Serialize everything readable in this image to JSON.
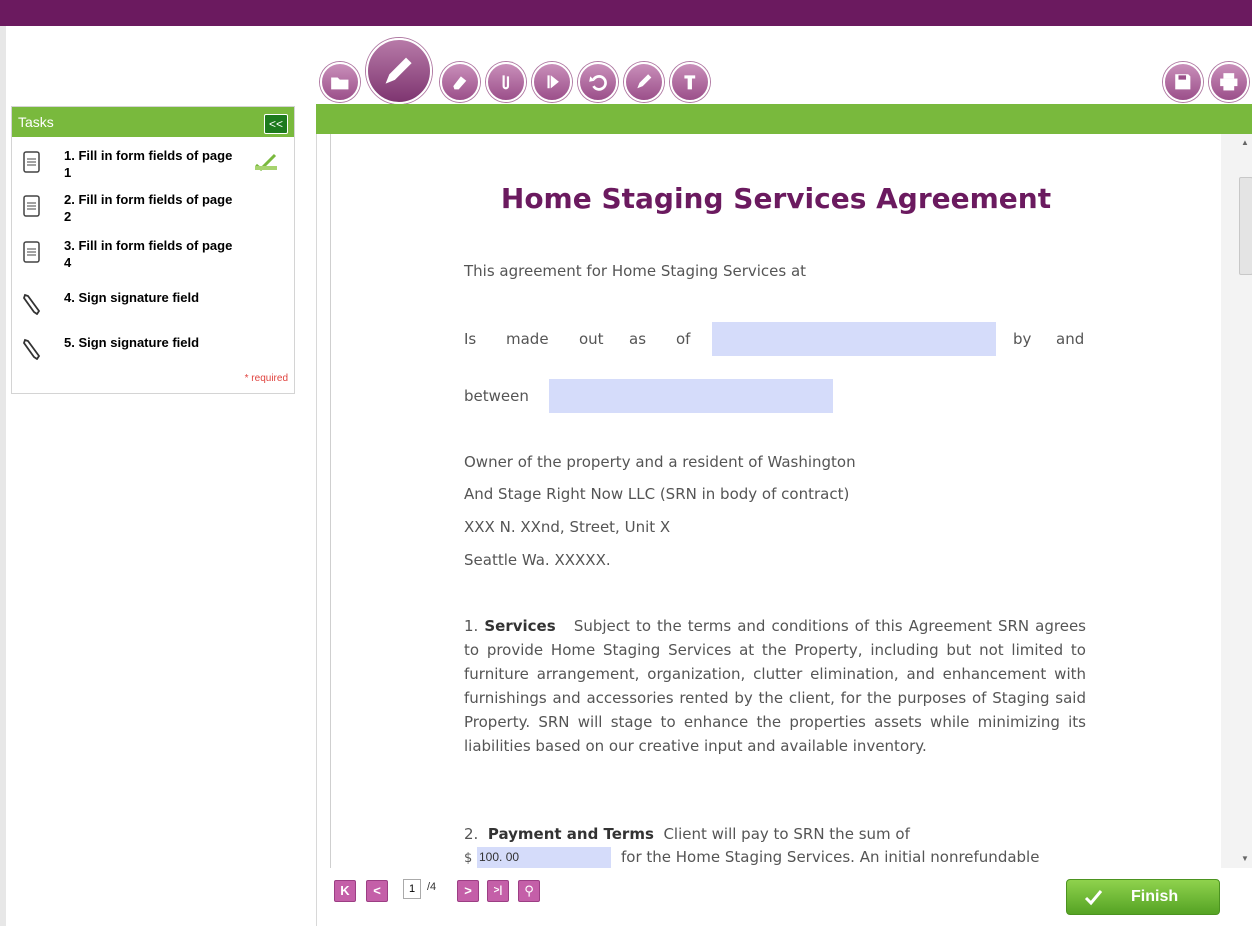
{
  "tasks": {
    "title": "Tasks",
    "collapse_label": "<<",
    "items": [
      {
        "label": "1. Fill in form fields of page 1"
      },
      {
        "label": "2. Fill in form fields of page 2"
      },
      {
        "label": "3. Fill in form fields of page 4"
      },
      {
        "label": "4. Sign signature field"
      },
      {
        "label": "5. Sign signature field"
      }
    ],
    "required_note": "* required"
  },
  "document": {
    "title": "Home Staging Services Agreement",
    "line1": "This agreement for Home Staging Services at",
    "made_is": "Is",
    "made_made": "made",
    "made_out": "out",
    "made_as": "as",
    "made_of": "of",
    "made_by": "by",
    "made_and": "and",
    "between": "between",
    "party_lines": [
      "Owner of the property and a resident of Washington",
      "And Stage Right Now LLC (SRN in body of contract)",
      "XXX N. XXnd, Street, Unit X",
      "Seattle Wa. XXXXX."
    ],
    "services_num": "1.",
    "services_heading": "Services",
    "services_body": "Subject to the terms and conditions of this Agreement SRN agrees to provide Home Staging Services at the Property, including but not limited to furniture arrangement, organization, clutter elimination, and enhancement with furnishings and accessories rented by the client, for the purposes of Staging said Property. SRN will stage to enhance the properties assets while minimizing its liabilities based on our creative input and available inventory.",
    "payment_num": "2.",
    "payment_heading": "Payment and Terms",
    "payment_body": "Client will pay to SRN the sum of",
    "dollar": "$",
    "amount_value": "100. 00",
    "payment_tail": "for the Home Staging Services. An initial nonrefundable"
  },
  "nav": {
    "first": "K",
    "prev": "<",
    "page_current": "1",
    "page_total": "/4",
    "next": ">",
    "last": ">|",
    "zoom": "⚲"
  },
  "finish_label": "Finish",
  "colors": {
    "brand_purple": "#6b1a5f",
    "green": "#79b93d",
    "field": "#d5dcfa"
  }
}
